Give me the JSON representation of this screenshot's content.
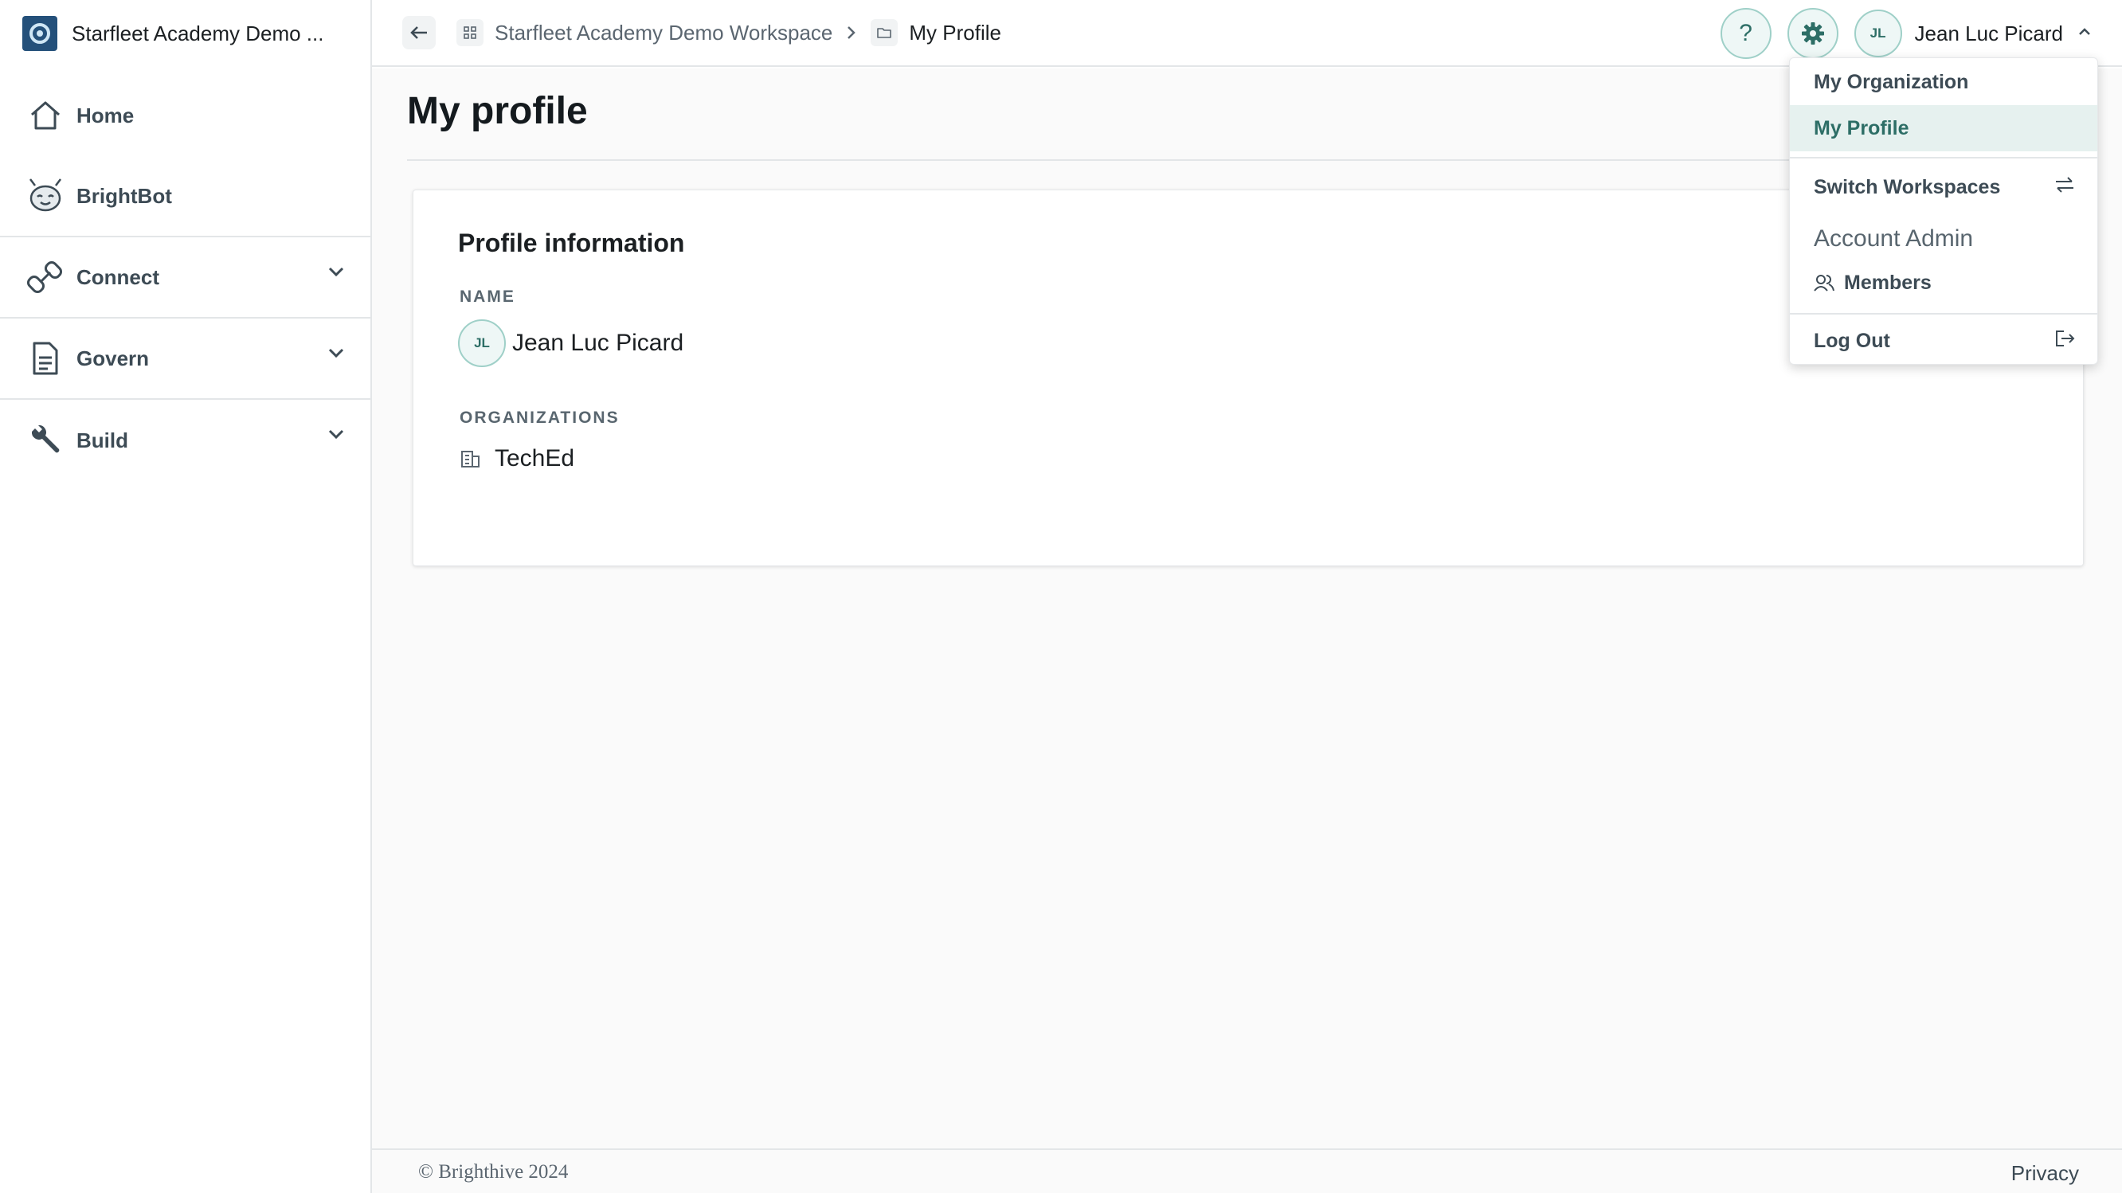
{
  "sidebar": {
    "workspace_name": "Starfleet Academy Demo ...",
    "items": [
      {
        "label": "Home",
        "icon": "home-icon"
      },
      {
        "label": "BrightBot",
        "icon": "brightbot-icon"
      },
      {
        "label": "Connect",
        "icon": "link-icon"
      },
      {
        "label": "Govern",
        "icon": "document-icon"
      },
      {
        "label": "Build",
        "icon": "wrench-icon"
      }
    ]
  },
  "breadcrumb": {
    "workspace": "Starfleet Academy Demo Workspace",
    "current": "My Profile"
  },
  "topbar": {
    "help_label": "?",
    "user_initials": "JL",
    "user_name": "Jean Luc Picard"
  },
  "main": {
    "title": "My profile",
    "card": {
      "title": "Profile information",
      "name_label": "NAME",
      "name_initials": "JL",
      "name_value": "Jean Luc Picard",
      "orgs_label": "ORGANIZATIONS",
      "org_value": "TechEd"
    }
  },
  "menu": {
    "my_organization": "My Organization",
    "my_profile": "My Profile",
    "switch_workspaces": "Switch Workspaces",
    "account_admin": "Account Admin",
    "members": "Members",
    "log_out": "Log Out"
  },
  "footer": {
    "copyright": "© Brighthive 2024",
    "privacy": "Privacy"
  },
  "colors": {
    "accent": "#2d6e66",
    "accent_bg": "#e6f1ef",
    "sidebar_text": "#3d4b55"
  }
}
